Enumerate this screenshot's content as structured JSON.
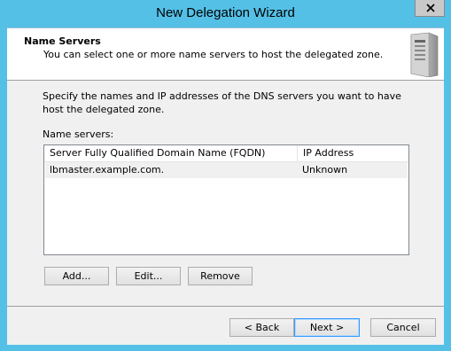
{
  "window": {
    "title": "New Delegation Wizard"
  },
  "header": {
    "title": "Name Servers",
    "subtitle": "You can select one or more name servers to host the delegated zone.",
    "icon": "server-icon"
  },
  "body": {
    "description": "Specify the names and IP addresses of the DNS servers you want to have host the delegated zone.",
    "list_label": "Name servers:",
    "columns": [
      "Server Fully Qualified Domain Name (FQDN)",
      "IP Address"
    ],
    "rows": [
      {
        "fqdn": "lbmaster.example.com.",
        "ip": "Unknown"
      }
    ],
    "buttons": {
      "add": "Add...",
      "edit": "Edit...",
      "remove": "Remove"
    }
  },
  "footer": {
    "back": "< Back",
    "next": "Next >",
    "cancel": "Cancel"
  }
}
